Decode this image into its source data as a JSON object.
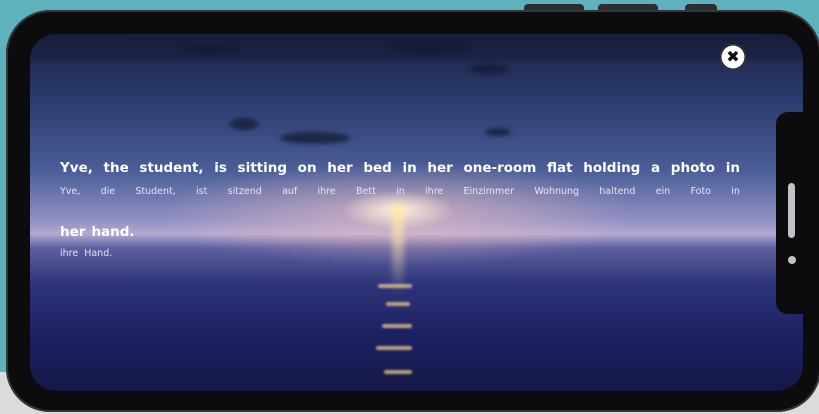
{
  "colors": {
    "backdrop": "#5fb2bd",
    "device_frame": "#0c0c0f",
    "english_text": "#ffffff",
    "german_text": "#e6e6f0"
  },
  "icons": {
    "close": "close-icon"
  },
  "close_button": {
    "glyph": "✖"
  },
  "sentence_line_1": {
    "english": [
      "Yve,",
      "the",
      "student,",
      "is",
      "sitting",
      "on",
      "her",
      "bed",
      "in",
      "her",
      "one-room",
      "flat",
      "holding",
      "a",
      "photo",
      "in"
    ],
    "german": [
      "Yve,",
      "die",
      "Student,",
      "ist",
      "sitzend",
      "auf",
      "ihre",
      "Bett",
      "in",
      "ihre",
      "Einzimmer",
      "Wohnung",
      "haltend",
      "ein",
      "Foto",
      "in"
    ]
  },
  "sentence_line_2": {
    "english": [
      "her",
      "hand."
    ],
    "german": [
      "ihre",
      "Hand."
    ]
  }
}
